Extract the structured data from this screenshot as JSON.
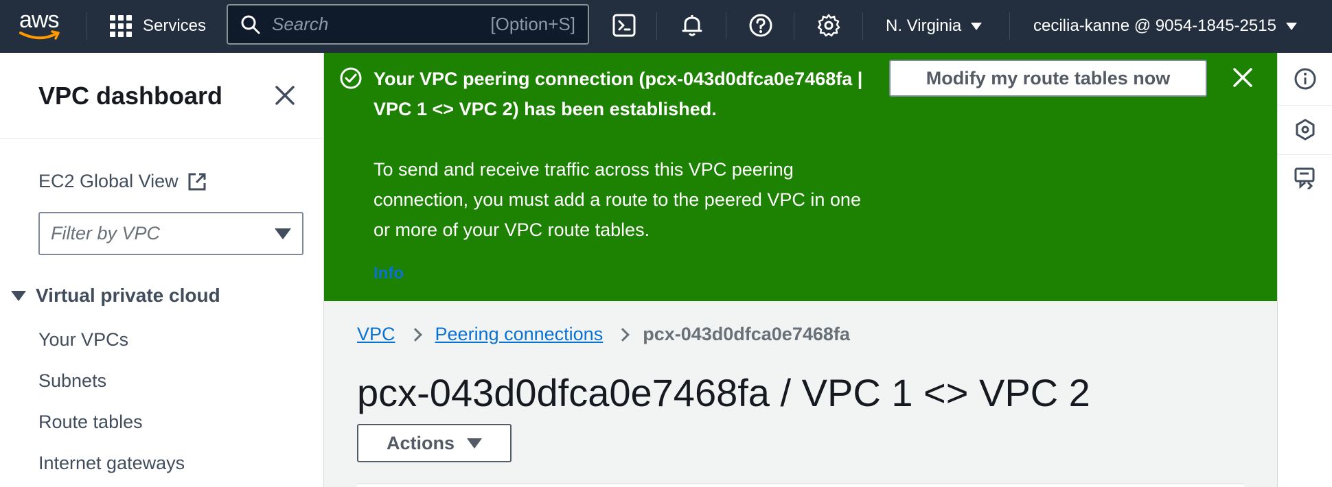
{
  "topnav": {
    "logo_text": "aws",
    "services_label": "Services",
    "search_placeholder": "Search",
    "search_shortcut": "[Option+S]",
    "region": "N. Virginia",
    "account": "cecilia-kanne @ 9054-1845-2515",
    "icons": [
      "cloudshell-icon",
      "bell-icon",
      "help-icon",
      "gear-icon"
    ]
  },
  "sidebar": {
    "title": "VPC dashboard",
    "global_view": "EC2 Global View",
    "filter_placeholder": "Filter by VPC",
    "section": "Virtual private cloud",
    "items": [
      {
        "label": "Your VPCs"
      },
      {
        "label": "Subnets"
      },
      {
        "label": "Route tables"
      },
      {
        "label": "Internet gateways"
      }
    ]
  },
  "flash": {
    "status": "success",
    "heading": "Your VPC peering connection (pcx-043d0dfca0e7468fa | VPC 1 <> VPC 2) has been established.",
    "body": "To send and receive traffic across this VPC peering connection, you must add a route to the peered VPC in one or more of your VPC route tables.",
    "info_link": "Info",
    "action_button": "Modify my route tables now",
    "color": "#1d8102"
  },
  "breadcrumb": {
    "items": [
      "VPC",
      "Peering connections"
    ],
    "current": "pcx-043d0dfca0e7468fa"
  },
  "page": {
    "title": "pcx-043d0dfca0e7468fa / VPC 1 <> VPC 2",
    "actions_label": "Actions"
  }
}
